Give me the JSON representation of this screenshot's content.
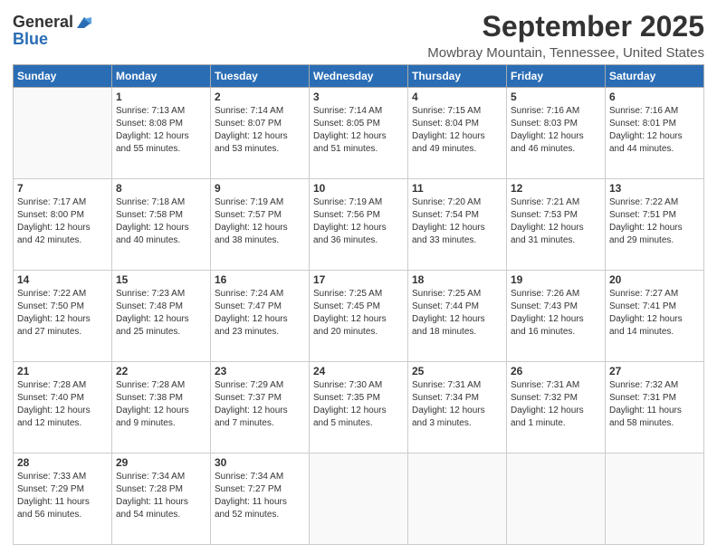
{
  "logo": {
    "general": "General",
    "blue": "Blue"
  },
  "header": {
    "title": "September 2025",
    "subtitle": "Mowbray Mountain, Tennessee, United States"
  },
  "days_of_week": [
    "Sunday",
    "Monday",
    "Tuesday",
    "Wednesday",
    "Thursday",
    "Friday",
    "Saturday"
  ],
  "weeks": [
    [
      {
        "num": "",
        "info": ""
      },
      {
        "num": "1",
        "info": "Sunrise: 7:13 AM\nSunset: 8:08 PM\nDaylight: 12 hours\nand 55 minutes."
      },
      {
        "num": "2",
        "info": "Sunrise: 7:14 AM\nSunset: 8:07 PM\nDaylight: 12 hours\nand 53 minutes."
      },
      {
        "num": "3",
        "info": "Sunrise: 7:14 AM\nSunset: 8:05 PM\nDaylight: 12 hours\nand 51 minutes."
      },
      {
        "num": "4",
        "info": "Sunrise: 7:15 AM\nSunset: 8:04 PM\nDaylight: 12 hours\nand 49 minutes."
      },
      {
        "num": "5",
        "info": "Sunrise: 7:16 AM\nSunset: 8:03 PM\nDaylight: 12 hours\nand 46 minutes."
      },
      {
        "num": "6",
        "info": "Sunrise: 7:16 AM\nSunset: 8:01 PM\nDaylight: 12 hours\nand 44 minutes."
      }
    ],
    [
      {
        "num": "7",
        "info": "Sunrise: 7:17 AM\nSunset: 8:00 PM\nDaylight: 12 hours\nand 42 minutes."
      },
      {
        "num": "8",
        "info": "Sunrise: 7:18 AM\nSunset: 7:58 PM\nDaylight: 12 hours\nand 40 minutes."
      },
      {
        "num": "9",
        "info": "Sunrise: 7:19 AM\nSunset: 7:57 PM\nDaylight: 12 hours\nand 38 minutes."
      },
      {
        "num": "10",
        "info": "Sunrise: 7:19 AM\nSunset: 7:56 PM\nDaylight: 12 hours\nand 36 minutes."
      },
      {
        "num": "11",
        "info": "Sunrise: 7:20 AM\nSunset: 7:54 PM\nDaylight: 12 hours\nand 33 minutes."
      },
      {
        "num": "12",
        "info": "Sunrise: 7:21 AM\nSunset: 7:53 PM\nDaylight: 12 hours\nand 31 minutes."
      },
      {
        "num": "13",
        "info": "Sunrise: 7:22 AM\nSunset: 7:51 PM\nDaylight: 12 hours\nand 29 minutes."
      }
    ],
    [
      {
        "num": "14",
        "info": "Sunrise: 7:22 AM\nSunset: 7:50 PM\nDaylight: 12 hours\nand 27 minutes."
      },
      {
        "num": "15",
        "info": "Sunrise: 7:23 AM\nSunset: 7:48 PM\nDaylight: 12 hours\nand 25 minutes."
      },
      {
        "num": "16",
        "info": "Sunrise: 7:24 AM\nSunset: 7:47 PM\nDaylight: 12 hours\nand 23 minutes."
      },
      {
        "num": "17",
        "info": "Sunrise: 7:25 AM\nSunset: 7:45 PM\nDaylight: 12 hours\nand 20 minutes."
      },
      {
        "num": "18",
        "info": "Sunrise: 7:25 AM\nSunset: 7:44 PM\nDaylight: 12 hours\nand 18 minutes."
      },
      {
        "num": "19",
        "info": "Sunrise: 7:26 AM\nSunset: 7:43 PM\nDaylight: 12 hours\nand 16 minutes."
      },
      {
        "num": "20",
        "info": "Sunrise: 7:27 AM\nSunset: 7:41 PM\nDaylight: 12 hours\nand 14 minutes."
      }
    ],
    [
      {
        "num": "21",
        "info": "Sunrise: 7:28 AM\nSunset: 7:40 PM\nDaylight: 12 hours\nand 12 minutes."
      },
      {
        "num": "22",
        "info": "Sunrise: 7:28 AM\nSunset: 7:38 PM\nDaylight: 12 hours\nand 9 minutes."
      },
      {
        "num": "23",
        "info": "Sunrise: 7:29 AM\nSunset: 7:37 PM\nDaylight: 12 hours\nand 7 minutes."
      },
      {
        "num": "24",
        "info": "Sunrise: 7:30 AM\nSunset: 7:35 PM\nDaylight: 12 hours\nand 5 minutes."
      },
      {
        "num": "25",
        "info": "Sunrise: 7:31 AM\nSunset: 7:34 PM\nDaylight: 12 hours\nand 3 minutes."
      },
      {
        "num": "26",
        "info": "Sunrise: 7:31 AM\nSunset: 7:32 PM\nDaylight: 12 hours\nand 1 minute."
      },
      {
        "num": "27",
        "info": "Sunrise: 7:32 AM\nSunset: 7:31 PM\nDaylight: 11 hours\nand 58 minutes."
      }
    ],
    [
      {
        "num": "28",
        "info": "Sunrise: 7:33 AM\nSunset: 7:29 PM\nDaylight: 11 hours\nand 56 minutes."
      },
      {
        "num": "29",
        "info": "Sunrise: 7:34 AM\nSunset: 7:28 PM\nDaylight: 11 hours\nand 54 minutes."
      },
      {
        "num": "30",
        "info": "Sunrise: 7:34 AM\nSunset: 7:27 PM\nDaylight: 11 hours\nand 52 minutes."
      },
      {
        "num": "",
        "info": ""
      },
      {
        "num": "",
        "info": ""
      },
      {
        "num": "",
        "info": ""
      },
      {
        "num": "",
        "info": ""
      }
    ]
  ]
}
